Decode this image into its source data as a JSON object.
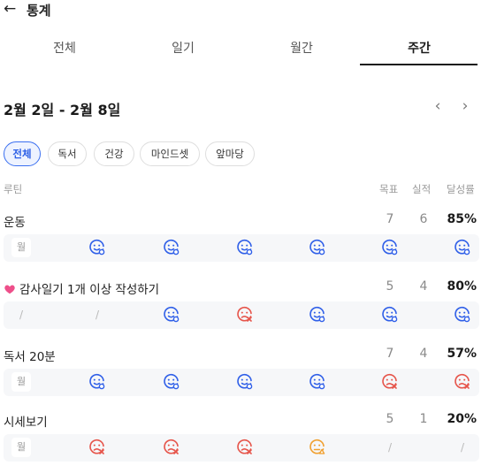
{
  "header": {
    "back_icon": "arrow-left-icon",
    "title": "통계"
  },
  "tabs": [
    {
      "label": "전체",
      "active": false
    },
    {
      "label": "일기",
      "active": false
    },
    {
      "label": "월간",
      "active": false
    },
    {
      "label": "주간",
      "active": true
    }
  ],
  "period": {
    "range": "2월 2일 - 2월 8일",
    "prev_icon": "chevron-left-icon",
    "next_icon": "chevron-right-icon"
  },
  "filters": [
    {
      "label": "전체",
      "active": true
    },
    {
      "label": "독서",
      "active": false
    },
    {
      "label": "건강",
      "active": false
    },
    {
      "label": "마인드셋",
      "active": false
    },
    {
      "label": "앞마당",
      "active": false
    }
  ],
  "columns": {
    "routine": "루틴",
    "goal": "목표",
    "done": "실적",
    "rate": "달성률"
  },
  "routines": [
    {
      "name": "운동",
      "emoji": "",
      "goal": "7",
      "done": "6",
      "rate": "85%",
      "days": [
        "label:월",
        "success",
        "success",
        "success",
        "success",
        "success",
        "success"
      ]
    },
    {
      "name": "감사일기 1개 이상 작성하기",
      "emoji": "pink-heart-icon",
      "goal": "5",
      "done": "4",
      "rate": "80%",
      "days": [
        "slash",
        "slash",
        "success",
        "fail",
        "success",
        "success",
        "success"
      ]
    },
    {
      "name": "독서 20분",
      "emoji": "",
      "goal": "7",
      "done": "4",
      "rate": "57%",
      "days": [
        "label:월",
        "success",
        "success",
        "success",
        "success",
        "fail",
        "fail"
      ]
    },
    {
      "name": "시세보기",
      "emoji": "",
      "goal": "5",
      "done": "1",
      "rate": "20%",
      "days": [
        "label:월",
        "fail",
        "fail",
        "fail",
        "warn",
        "slash",
        "slash"
      ]
    }
  ],
  "day_slash": "/",
  "colors": {
    "accent": "#3a6ff0",
    "success": "#2f5fe8",
    "fail": "#e6544a",
    "warn": "#f0a030"
  }
}
